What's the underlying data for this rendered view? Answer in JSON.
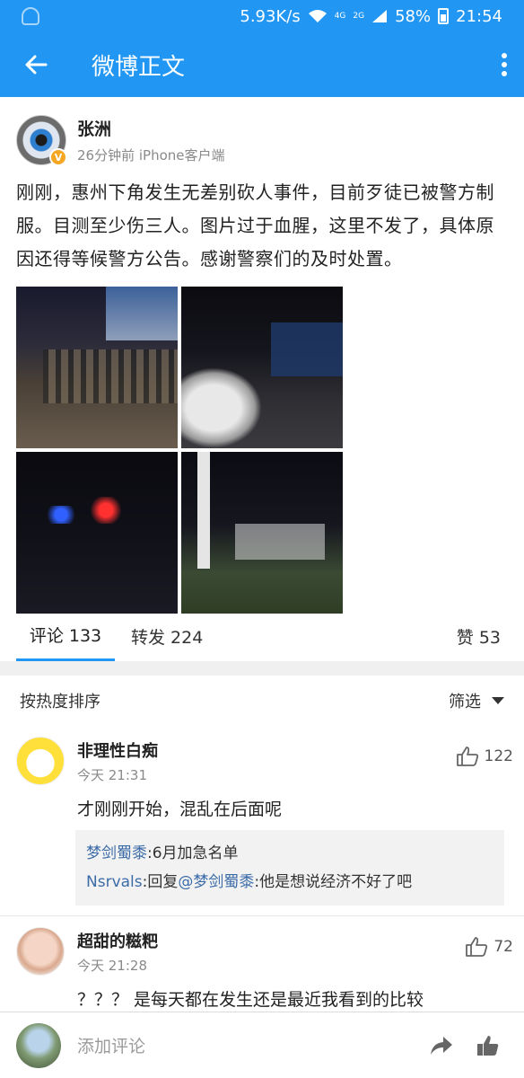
{
  "status_bar": {
    "network_speed": "5.93K/s",
    "net_tag_1": "4G",
    "net_tag_2": "2G",
    "battery": "58%",
    "time": "21:54"
  },
  "app_bar": {
    "title": "微博正文",
    "back_icon": "arrow-left-icon",
    "more_icon": "more-vertical-icon"
  },
  "post": {
    "author": "张洲",
    "meta": "26分钟前  iPhone客户端",
    "text": "刚刚，惠州下角发生无差别砍人事件，目前歹徒已被警方制服。目测至少伤三人。图片过于血腥，这里不发了，具体原因还得等候警方公告。感谢警察们的及时处置。",
    "image_count": 4
  },
  "tabs": {
    "comments": "评论 133",
    "reposts": "转发 224",
    "likes": "赞 53"
  },
  "sort": {
    "label": "按热度排序",
    "filter": "筛选"
  },
  "comments": [
    {
      "name": "非理性白痴",
      "time": "今天 21:31",
      "likes": "122",
      "text": "才刚刚开始，混乱在后面呢",
      "replies": [
        {
          "user": "梦剑蜀黍",
          "text": ":6月加急名单"
        },
        {
          "user": "Nsrvals",
          "text_before": ":回复",
          "mention": "@梦剑蜀黍",
          "text": ":他是想说经济不好了吧"
        }
      ]
    },
    {
      "name": "超甜的糍粑",
      "time": "今天 21:28",
      "likes": "72",
      "text": "？？？ 是每天都在发生还是最近我看到的比较"
    }
  ],
  "bottom_bar": {
    "placeholder": "添加评论",
    "share_icon": "share-arrow-icon",
    "like_icon": "thumbs-up-icon"
  },
  "colors": {
    "primary": "#2196f3",
    "link": "#3c6ca8",
    "verified": "#f5a623"
  }
}
